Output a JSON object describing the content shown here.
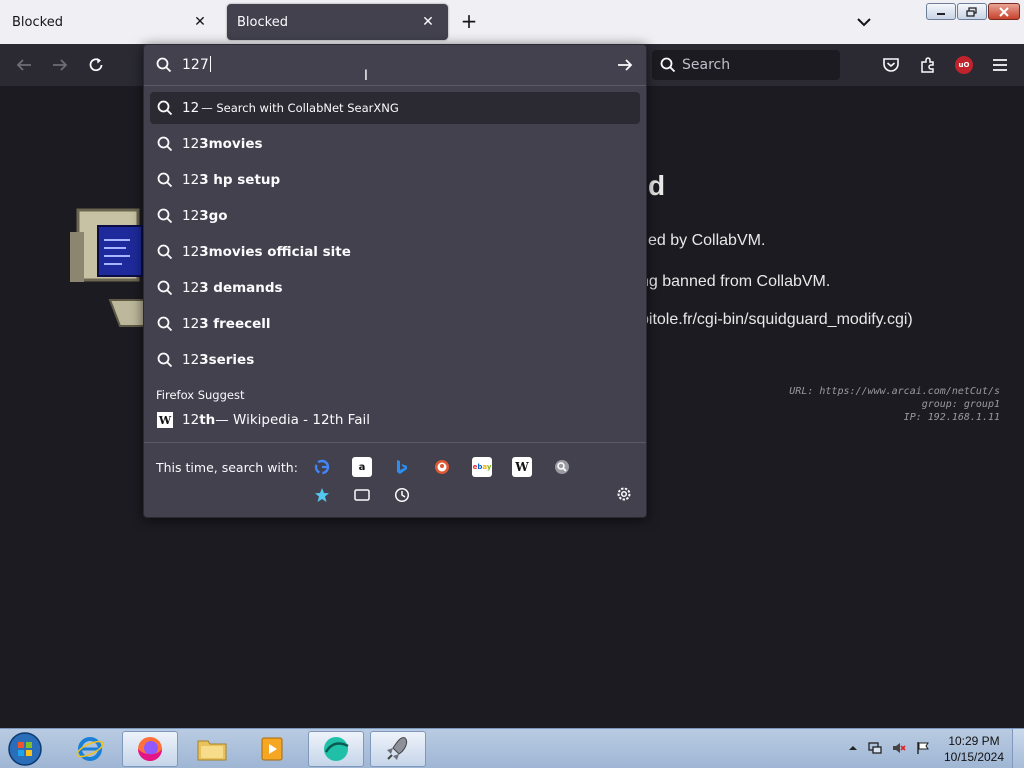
{
  "tabs": [
    {
      "title": "Blocked",
      "active": false
    },
    {
      "title": "Blocked",
      "active": true
    }
  ],
  "toolbar": {
    "search_placeholder": "Search"
  },
  "urlbar": {
    "typed_text": "127",
    "suggestions": [
      {
        "prefix": "12",
        "bold": "",
        "suffix": " — Search with CollabNet SearXNG",
        "selected": true
      },
      {
        "prefix": "12",
        "bold": "3movies",
        "suffix": ""
      },
      {
        "prefix": "12",
        "bold": "3 hp setup",
        "suffix": ""
      },
      {
        "prefix": "12",
        "bold": "3go",
        "suffix": ""
      },
      {
        "prefix": "12",
        "bold": "3movies official site",
        "suffix": ""
      },
      {
        "prefix": "12",
        "bold": "3 demands",
        "suffix": ""
      },
      {
        "prefix": "12",
        "bold": "3 freecell",
        "suffix": ""
      },
      {
        "prefix": "12",
        "bold": "3series",
        "suffix": ""
      }
    ],
    "firefox_suggest_label": "Firefox Suggest",
    "wiki_suggestion": {
      "prefix": "12",
      "bold": "th",
      "suffix": " — Wikipedia - 12th Fail"
    },
    "oneoff_label": "This time, search with:",
    "engines": [
      "google",
      "amazon",
      "bing",
      "duckduckgo",
      "ebay",
      "wikipedia",
      "searxng"
    ],
    "modes": [
      "bookmarks",
      "tabs",
      "history"
    ]
  },
  "page": {
    "title_fragment": "d",
    "line1": "ed by CollabVM.",
    "line2": "ng banned from CollabVM.",
    "line3": "pitole.fr/cgi-bin/squidguard_modify.cgi)",
    "meta_url": "URL: https://www.arcai.com/netCut/s",
    "meta_group": "group: group1",
    "meta_ip": "IP: 192.168.1.11"
  },
  "taskbar": {
    "time": "10:29 PM",
    "date": "10/15/2024"
  },
  "colors": {
    "accent": "#2b2a33",
    "panel": "#42414d",
    "page_bg": "#1c1b22"
  }
}
